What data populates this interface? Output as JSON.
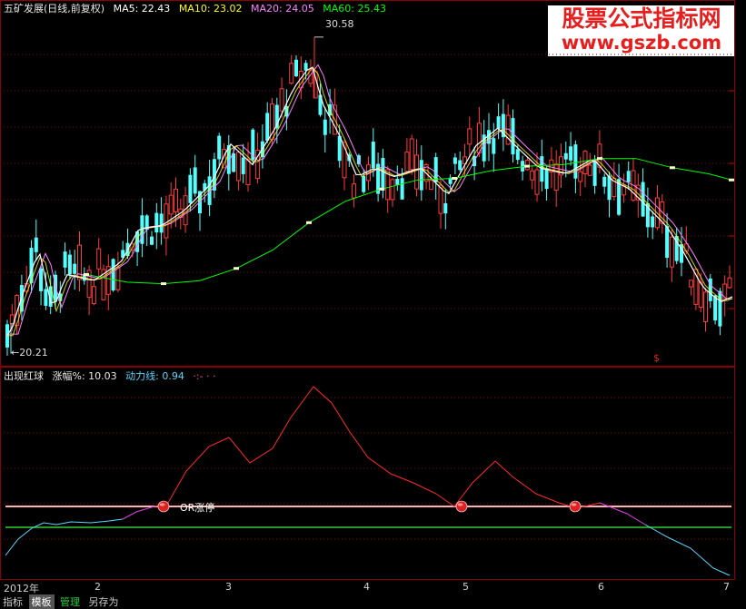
{
  "header": {
    "title": "五矿发展(日线,前复权)",
    "ma5": "MA5: 22.43",
    "ma10": "MA10: 23.02",
    "ma20": "MA20: 24.05",
    "ma60": "MA60: 25.43"
  },
  "price_labels": {
    "high": "30.58",
    "low": "←20.21"
  },
  "indicator": {
    "name": "出现红球",
    "rise": "涨幅%: 10.03",
    "power": "动力线: 0.94",
    "marker": "·:- · ·",
    "annotation": "OR涨停"
  },
  "date_axis": [
    "2012年",
    "2",
    "3",
    "4",
    "5",
    "6",
    "7"
  ],
  "bottom_tabs": [
    "指标",
    "模板",
    "管理",
    "另存为"
  ],
  "dollar_sign": "$",
  "watermark": {
    "line1": "股票公式指标网",
    "line2": "www.gszb.com"
  },
  "colors": {
    "up": "#ff3b3b",
    "down": "#54ffff",
    "ma5": "#ffffff",
    "ma10": "#ffff00",
    "ma20": "#ff80ff",
    "ma60": "#00ff00",
    "grid": "#8b0000",
    "ind_red": "#ff2a2a",
    "ind_cyan": "#5ad6ff",
    "ind_magenta": "#e040e0",
    "line_pink": "#ffb0b0",
    "line_green": "#30d030"
  },
  "chart_data": {
    "type": "line",
    "title": "五矿发展(日线,前复权)",
    "price_high": 30.58,
    "price_low": 20.21,
    "series": [
      {
        "name": "MA5",
        "values": [
          20.6,
          21.3,
          22.2,
          22.8,
          23.5,
          24.3,
          25.4,
          26.5,
          28.9,
          28.3,
          26.3,
          25.9,
          26.0,
          26.4,
          27.4,
          26.6,
          26.3,
          26.2,
          25.7,
          25.4,
          24.6,
          23.3,
          22.4
        ]
      },
      {
        "name": "MA60",
        "values": [
          22.7,
          22.7,
          22.6,
          22.6,
          22.7,
          23.0,
          23.5,
          24.3,
          25.0,
          25.5,
          26.0,
          26.2,
          26.2,
          26.3,
          26.3,
          26.3,
          26.2,
          26.1,
          26.0,
          25.9,
          25.8,
          25.6,
          25.43
        ]
      }
    ],
    "indicator": {
      "name": "出现红球",
      "涨幅%": 10.03,
      "动力线": 0.94
    }
  }
}
